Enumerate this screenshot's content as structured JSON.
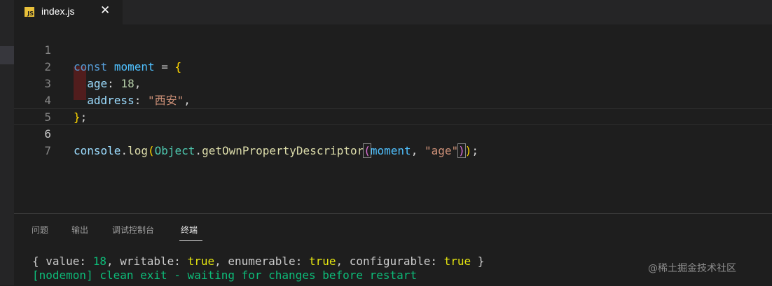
{
  "tab": {
    "icon_text": "JS",
    "filename": "index.js",
    "close_glyph": "✕"
  },
  "editor": {
    "line_numbers": [
      "1",
      "2",
      "3",
      "4",
      "5",
      "6",
      "7"
    ],
    "code": {
      "l1_kw": "const",
      "l1_var": "moment",
      "l1_eq": " = ",
      "l1_brace": "{",
      "l2_prop": "age",
      "l2_colon": ": ",
      "l2_num": "18",
      "l2_comma": ",",
      "l3_prop": "address",
      "l3_colon": ": ",
      "l3_str": "\"西安\"",
      "l3_comma": ",",
      "l4_brace": "}",
      "l4_semi": ";",
      "l6_console": "console",
      "l6_dot": ".",
      "l6_log": "log",
      "l6_p1": "(",
      "l6_obj": "Object",
      "l6_dot2": ".",
      "l6_fn": "getOwnPropertyDescriptor",
      "l6_p2": "(",
      "l6_arg1": "moment",
      "l6_sep": ", ",
      "l6_arg2": "\"age\"",
      "l6_p2c": ")",
      "l6_p1c": ")",
      "l6_semi": ";"
    }
  },
  "panel": {
    "tabs": [
      "问题",
      "输出",
      "调试控制台",
      "终端"
    ],
    "active_tab": "终端",
    "terminal": {
      "line1": {
        "open": "{ value: ",
        "value": "18",
        "mid1": ", writable: ",
        "writable": "true",
        "mid2": ", enumerable: ",
        "enumerable": "true",
        "mid3": ", configurable: ",
        "configurable": "true",
        "close": " }"
      },
      "line2": "[nodemon] clean exit - waiting for changes before restart"
    }
  },
  "watermark": "@稀土掘金技术社区",
  "colors": {
    "editor_bg": "#1e1e1e",
    "tab_bar_bg": "#252526",
    "js_icon": "#e8c03a",
    "terminal_green": "#0dbc79"
  }
}
